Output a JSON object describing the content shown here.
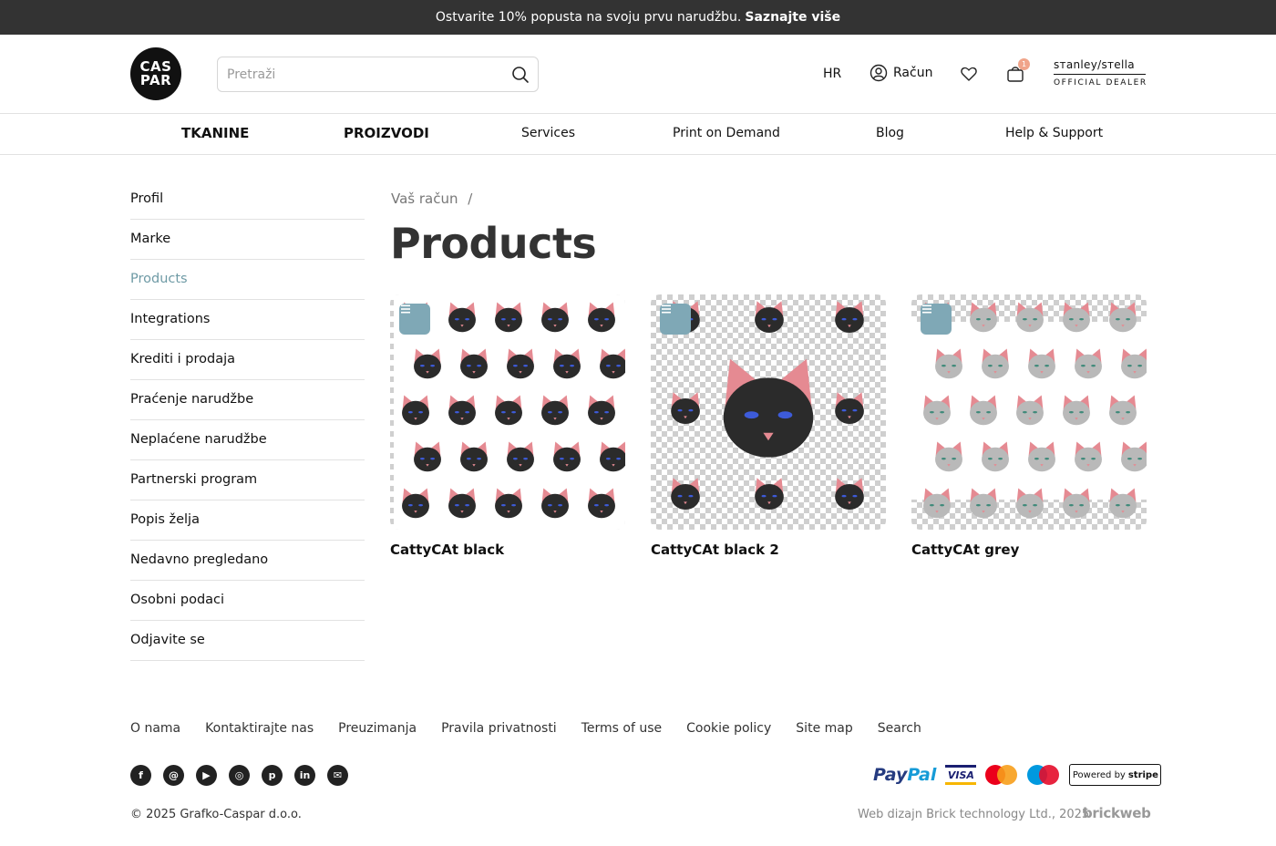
{
  "promo": {
    "text": "Ostvarite 10% popusta na svoju prvu narudžbu.",
    "link": "Saznajte više"
  },
  "header": {
    "logo_top": "CAS",
    "logo_bottom": "PAR",
    "search_placeholder": "Pretraži",
    "language": "HR",
    "account_label": "Račun",
    "cart_count": "1",
    "dealer_brand": "sтanley/sтella",
    "dealer_sub": "OFFICIAL DEALER"
  },
  "nav": {
    "items": [
      "TKANINE",
      "PROIZVODI",
      "Services",
      "Print on Demand",
      "Blog",
      "Help & Support"
    ]
  },
  "sidebar": {
    "items": [
      "Profil",
      "Marke",
      "Products",
      "Integrations",
      "Krediti i prodaja",
      "Praćenje narudžbe",
      "Neplaćene narudžbe",
      "Partnerski program",
      "Popis želja",
      "Nedavno pregledano",
      "Osobni podaci",
      "Odjavite se"
    ],
    "active": "Products"
  },
  "main": {
    "breadcrumb": "Vaš račun",
    "breadcrumb_sep": "/",
    "title": "Products",
    "products": [
      {
        "name": "CattyCAt black",
        "pattern": "tiled-black-cats",
        "fur": "#2b2b2b",
        "eye": "#3d5bd9"
      },
      {
        "name": "CattyCAt black 2",
        "pattern": "big-black-cat-with-small-cats",
        "fur": "#2b2b2b",
        "eye": "#3d5bd9"
      },
      {
        "name": "CattyCAt grey",
        "pattern": "tiled-grey-cats",
        "fur": "#b9b9b9",
        "eye": "#3f8a7a"
      }
    ]
  },
  "footer": {
    "links": [
      "O nama",
      "Kontaktirajte nas",
      "Preuzimanja",
      "Pravila privatnosti",
      "Terms of use",
      "Cookie policy",
      "Site map",
      "Search"
    ],
    "social": [
      "facebook-icon",
      "threads-icon",
      "youtube-icon",
      "instagram-icon",
      "pinterest-icon",
      "linkedin-icon",
      "email-icon"
    ],
    "payment": {
      "paypal_a": "Pay",
      "paypal_b": "Pal",
      "visa": "VISA",
      "powered": "Powered by",
      "stripe": "stripe"
    },
    "copyright": "© 2025  Grafko-Caspar d.o.o.",
    "credit": "Web dizajn Brick technology Ltd., 2025",
    "credit_logo": "brickweb"
  },
  "colors": {
    "accent": "#6e9aa5",
    "menu_button": "#7fa8b6",
    "promo_bg": "#333333",
    "ear_pink": "#e58a92"
  }
}
